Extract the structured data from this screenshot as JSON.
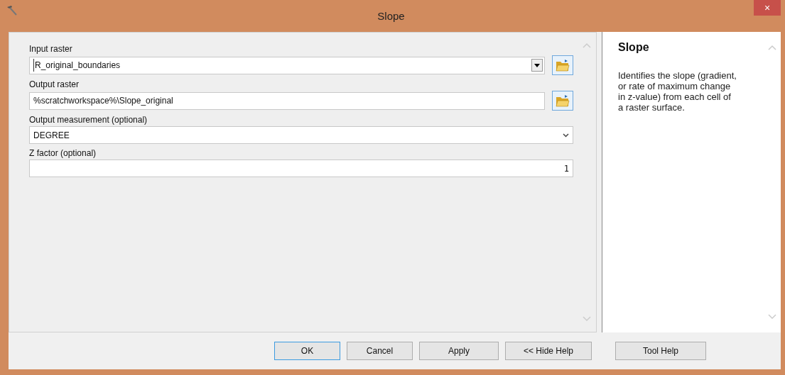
{
  "window": {
    "title": "Slope",
    "close": "×"
  },
  "parameters": [
    {
      "kind": "combo",
      "label": "Input raster",
      "value": "R_original_boundaries",
      "browse": true
    },
    {
      "kind": "text",
      "label": "Output raster",
      "value": "%scratchworkspace%\\Slope_original",
      "browse": true
    },
    {
      "kind": "select",
      "label": "Output measurement (optional)",
      "value": "DEGREE",
      "browse": false
    },
    {
      "kind": "number",
      "label": "Z factor (optional)",
      "value": "1",
      "browse": false
    }
  ],
  "help": {
    "title": "Slope",
    "text": "Identifies the slope (gradient, or rate of maximum change in z-value) from each cell of a raster surface."
  },
  "buttons": [
    {
      "label": "OK",
      "focused": true
    },
    {
      "label": "Cancel",
      "focused": false
    },
    {
      "label": "Apply",
      "focused": false
    },
    {
      "label": "<< Hide Help",
      "focused": false
    },
    {
      "label": "Tool Help",
      "focused": false
    }
  ]
}
